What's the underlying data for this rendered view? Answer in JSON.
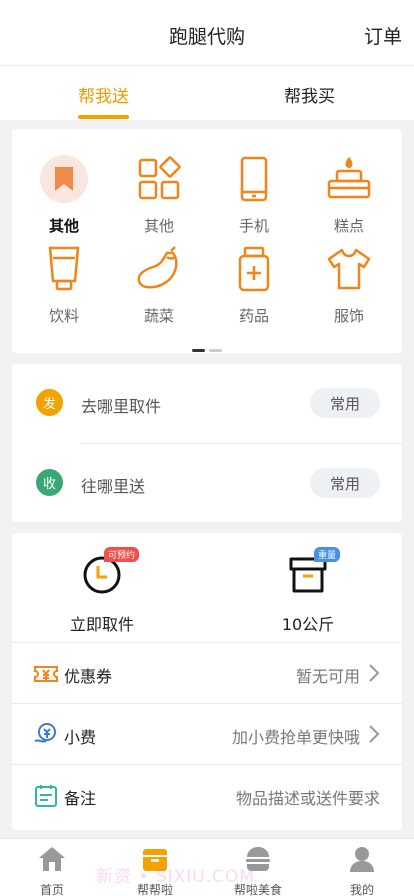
{
  "header": {
    "title": "跑腿代购",
    "right_action": "订单"
  },
  "tabs": [
    {
      "label": "帮我送",
      "active": true
    },
    {
      "label": "帮我买",
      "active": false
    }
  ],
  "categories": [
    {
      "label": "其他",
      "icon": "bookmark-icon",
      "active": true
    },
    {
      "label": "其他",
      "icon": "grid-shapes-icon",
      "active": false
    },
    {
      "label": "手机",
      "icon": "phone-icon",
      "active": false
    },
    {
      "label": "糕点",
      "icon": "cake-icon",
      "active": false
    },
    {
      "label": "饮料",
      "icon": "tube-icon",
      "active": false
    },
    {
      "label": "蔬菜",
      "icon": "eggplant-icon",
      "active": false
    },
    {
      "label": "药品",
      "icon": "medicine-bottle-icon",
      "active": false
    },
    {
      "label": "服饰",
      "icon": "tshirt-icon",
      "active": false
    }
  ],
  "pager": {
    "current": 1,
    "total": 2
  },
  "address": {
    "pickup": {
      "badge": "发",
      "placeholder": "去哪里取件",
      "button": "常用",
      "badge_color": "#f5a200"
    },
    "dropoff": {
      "badge": "收",
      "placeholder": "往哪里送",
      "button": "常用",
      "badge_color": "#3aa876"
    }
  },
  "options": {
    "time": {
      "label": "立即取件",
      "tag": "可预约",
      "tag_color": "#f0504a"
    },
    "weight": {
      "label": "10公斤",
      "tag": "重量",
      "tag_color": "#4a90e2"
    }
  },
  "rows": {
    "coupon": {
      "label": "优惠券",
      "value": "暂无可用"
    },
    "tip": {
      "label": "小费",
      "value": "加小费抢单更快哦"
    },
    "note": {
      "label": "备注",
      "value": "物品描述或送件要求"
    }
  },
  "bottom_nav": [
    {
      "label": "首页",
      "icon": "home-icon",
      "active": false
    },
    {
      "label": "帮帮啦",
      "icon": "delivery-box-icon",
      "active": true
    },
    {
      "label": "帮啦美食",
      "icon": "burger-icon",
      "active": false
    },
    {
      "label": "我的",
      "icon": "user-icon",
      "active": false
    }
  ],
  "watermark": "新资 • SIXIU.COM",
  "colors": {
    "accent": "#f5a200",
    "icon_orange": "#f08519"
  }
}
